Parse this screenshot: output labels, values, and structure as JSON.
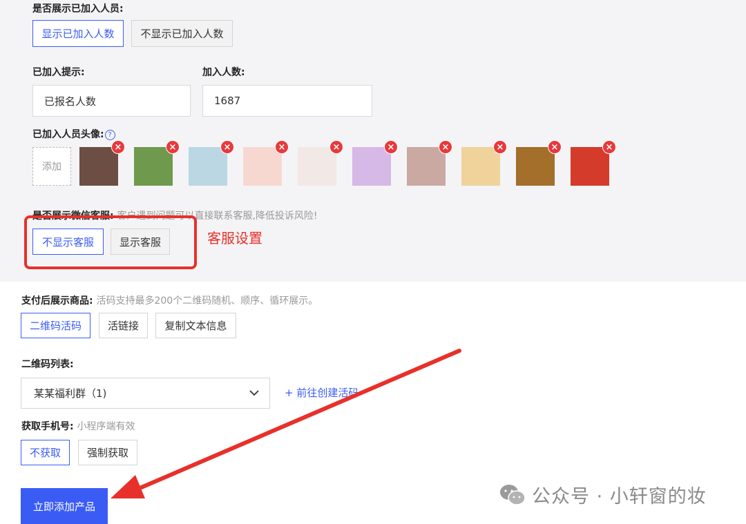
{
  "section1": {
    "show_joined_label": "是否展示已加入人员:",
    "buttons": [
      "显示已加入人数",
      "不显示已加入人数"
    ],
    "joined_tip_label": "已加入提示:",
    "joined_count_label": "加入人数:",
    "joined_tip_value": "已报名人数",
    "joined_count_value": "1687",
    "avatars_label": "已加入人员头像:",
    "help_icon": "?",
    "add_label": "添加",
    "delete_icon": "×",
    "avatar_colors": [
      "#6d4e44",
      "#6f9a4d",
      "#bcd7e4",
      "#f7d8d0",
      "#f2e8e6",
      "#d6b9e6",
      "#caa9a2",
      "#efd39a",
      "#a36f2b",
      "#d53b2a"
    ]
  },
  "wechat": {
    "label": "是否展示微信客服:",
    "hint": "客户遇到问题可以直接联系客服,降低投诉风险!",
    "buttons": [
      "不显示客服",
      "显示客服"
    ],
    "annotation": "客服设置"
  },
  "after_pay": {
    "label": "支付后展示商品:",
    "hint": "活码支持最多200个二维码随机、顺序、循环展示。",
    "buttons": [
      "二维码活码",
      "活链接",
      "复制文本信息"
    ]
  },
  "qr_list": {
    "label": "二维码列表:",
    "selected": "某某福利群（1)",
    "create_link": "+ 前往创建活码"
  },
  "phone": {
    "label": "获取手机号:",
    "hint": "小程序端有效",
    "buttons": [
      "不获取",
      "强制获取"
    ]
  },
  "submit_label": "立即添加产品",
  "watermark": "公众号 · 小轩窗的妆",
  "colors": {
    "accent": "#3a5cf5",
    "annotation": "#e8302a"
  }
}
